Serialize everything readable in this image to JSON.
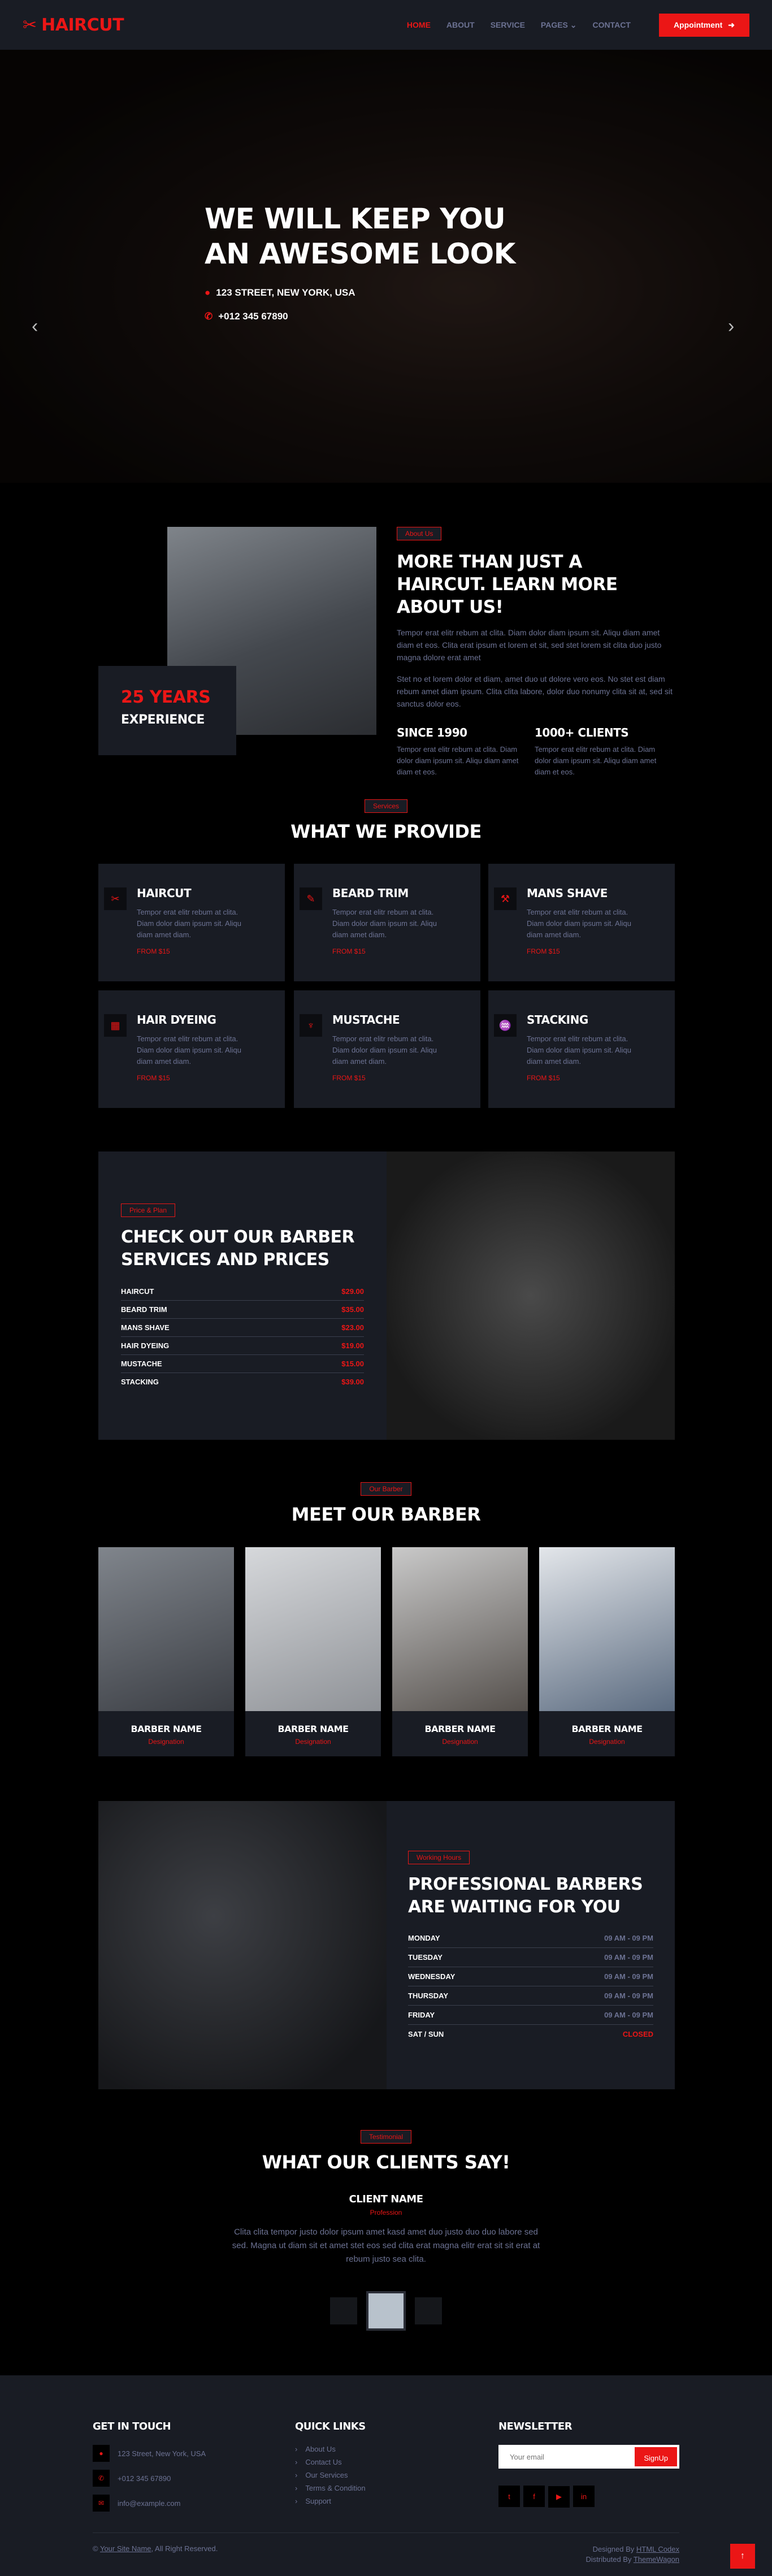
{
  "brand": {
    "name": "HAIRCUT"
  },
  "nav": {
    "items": [
      "HOME",
      "ABOUT",
      "SERVICE",
      "PAGES",
      "CONTACT"
    ],
    "appointment": "Appointment"
  },
  "hero": {
    "title": "WE WILL KEEP YOU AN AWESOME LOOK",
    "address": "123 STREET, NEW YORK, USA",
    "phone": "+012 345 67890"
  },
  "about": {
    "tag": "About Us",
    "title": "MORE THAN JUST A HAIRCUT. LEARN MORE ABOUT US!",
    "para1": "Tempor erat elitr rebum at clita. Diam dolor diam ipsum sit. Aliqu diam amet diam et eos. Clita erat ipsum et lorem et sit, sed stet lorem sit clita duo justo magna dolore erat amet",
    "para2": "Stet no et lorem dolor et diam, amet duo ut dolore vero eos. No stet est diam rebum amet diam ipsum. Clita clita labore, dolor duo nonumy clita sit at, sed sit sanctus dolor eos.",
    "years": "25 YEARS",
    "experience": "EXPERIENCE",
    "since": "SINCE 1990",
    "clients": "1000+ CLIENTS",
    "small": "Tempor erat elitr rebum at clita. Diam dolor diam ipsum sit. Aliqu diam amet diam et eos."
  },
  "services": {
    "tag": "Services",
    "title": "WHAT WE PROVIDE",
    "desc": "Tempor erat elitr rebum at clita. Diam dolor diam ipsum sit. Aliqu diam amet diam.",
    "from": "FROM $15",
    "items": [
      "HAIRCUT",
      "BEARD TRIM",
      "MANS SHAVE",
      "HAIR DYEING",
      "MUSTACHE",
      "STACKING"
    ]
  },
  "pricing": {
    "tag": "Price & Plan",
    "title": "CHECK OUT OUR BARBER SERVICES AND PRICES",
    "rows": [
      {
        "name": "HAIRCUT",
        "price": "$29.00"
      },
      {
        "name": "BEARD TRIM",
        "price": "$35.00"
      },
      {
        "name": "MANS SHAVE",
        "price": "$23.00"
      },
      {
        "name": "HAIR DYEING",
        "price": "$19.00"
      },
      {
        "name": "MUSTACHE",
        "price": "$15.00"
      },
      {
        "name": "STACKING",
        "price": "$39.00"
      }
    ]
  },
  "team": {
    "tag": "Our Barber",
    "title": "MEET OUR BARBER",
    "name": "BARBER NAME",
    "designation": "Designation"
  },
  "hours": {
    "tag": "Working Hours",
    "title": "PROFESSIONAL BARBERS ARE WAITING FOR YOU",
    "rows": [
      {
        "day": "MONDAY",
        "time": "09 AM - 09 PM"
      },
      {
        "day": "TUESDAY",
        "time": "09 AM - 09 PM"
      },
      {
        "day": "WEDNESDAY",
        "time": "09 AM - 09 PM"
      },
      {
        "day": "THURSDAY",
        "time": "09 AM - 09 PM"
      },
      {
        "day": "FRIDAY",
        "time": "09 AM - 09 PM"
      },
      {
        "day": "SAT / SUN",
        "time": "CLOSED"
      }
    ]
  },
  "testimonial": {
    "tag": "Testimonial",
    "title": "WHAT OUR CLIENTS SAY!",
    "client": "CLIENT NAME",
    "profession": "Profession",
    "quote": "Clita clita tempor justo dolor ipsum amet kasd amet duo justo duo duo labore sed sed. Magna ut diam sit et amet stet eos sed clita erat magna elitr erat sit sit erat at rebum justo sea clita."
  },
  "footer": {
    "touch_title": "GET IN TOUCH",
    "address": "123 Street, New York, USA",
    "phone": "+012 345 67890",
    "email": "info@example.com",
    "links_title": "QUICK LINKS",
    "links": [
      "About Us",
      "Contact Us",
      "Our Services",
      "Terms & Condition",
      "Support"
    ],
    "news_title": "NEWSLETTER",
    "email_placeholder": "Your email",
    "signup": "SignUp",
    "copyright": "Your Site Name",
    "rights": ", All Right Reserved.",
    "designed": "Designed By ",
    "designer": "HTML Codex",
    "distributed": "Distributed By ",
    "distributor": "ThemeWagon"
  },
  "colors": {
    "accent": "#eb1616",
    "panel": "#191c24",
    "muted": "#6c7293"
  }
}
